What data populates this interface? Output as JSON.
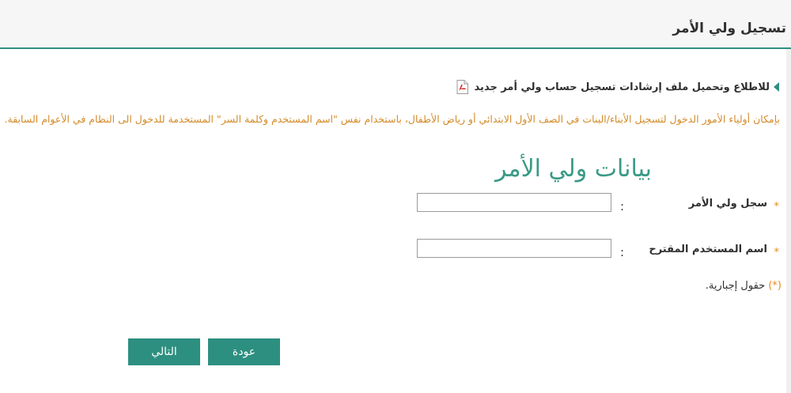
{
  "header": {
    "title": "تسجيل ولي الأمر"
  },
  "guide": {
    "link_text": "للاطلاع وتحميل ملف إرشادات تسجيل حساب ولي أمر جديد",
    "bullet_icon": "chevron-left-icon",
    "file_icon": "pdf-icon"
  },
  "note": {
    "text": "بإمكان أولياء الأمور الدخول لتسجيل الأبناء/البنات في الصف الأول الابتدائي أو رياض الأطفال، باستخدام نفس \"اسم المستخدم وكلمة السر\" المستخدمة للدخول الى النظام في الأعوام السابقة."
  },
  "form": {
    "section_title": "بيانات ولي الأمر",
    "fields": [
      {
        "label": "سجل ولي الأمر",
        "required_mark": "*",
        "colon": ":",
        "value": ""
      },
      {
        "label": "اسم المستخدم المقترح",
        "required_mark": "*",
        "colon": ":",
        "value": ""
      }
    ],
    "required_note_mark": "(*)",
    "required_note_text": "حقول إجبارية."
  },
  "buttons": {
    "back_label": "عودة",
    "next_label": "التالي"
  },
  "colors": {
    "accent": "#2d8f80",
    "title_green": "#3a9a86",
    "note_orange": "#d38b2a",
    "required_orange": "#e08a1e"
  }
}
